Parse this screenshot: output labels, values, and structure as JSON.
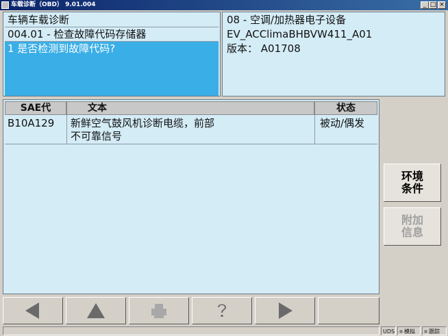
{
  "window": {
    "title": "车载诊断（OBD） 9.01.004",
    "minimize_glyph": "_",
    "maximize_glyph": "□",
    "close_glyph": "×"
  },
  "left_panel": {
    "line1": "车辆车载诊断",
    "line2": "004.01 - 检查故障代码存储器",
    "line3": "1 是否检测到故障代码?"
  },
  "right_panel": {
    "line1": "08 - 空调/加热器电子设备",
    "line2": "EV_ACClimaBHBVW411_A01",
    "line3": "版本： A01708"
  },
  "table": {
    "headers": {
      "code": "SAE代",
      "text": "文本",
      "status": "状态"
    },
    "rows": [
      {
        "code": "B10A129",
        "text_line1": "新鲜空气鼓风机诊断电缆，前部",
        "text_line2": "不可靠信号",
        "status": "被动/偶发"
      }
    ]
  },
  "side_buttons": {
    "environment": "环境条件",
    "additional_info": "附加信息"
  },
  "toolbar": {
    "back_icon": "arrow-left",
    "up_icon": "arrow-up",
    "print_icon": "printer",
    "help_icon": "question-mark",
    "forward_icon": "arrow-right"
  },
  "statusbar": {
    "uds": "UDS",
    "simulate": "模拟",
    "trace": "跟踪"
  }
}
